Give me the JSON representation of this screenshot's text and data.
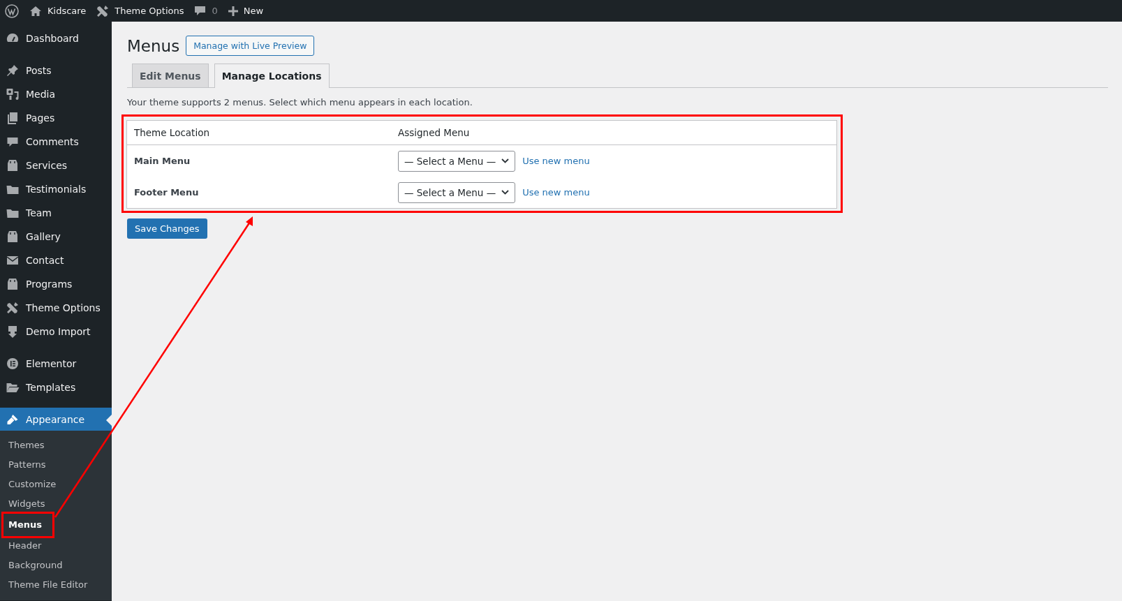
{
  "topbar": {
    "items": [
      {
        "kind": "logo"
      },
      {
        "kind": "home",
        "label": "Kidscare"
      },
      {
        "kind": "tools",
        "label": "Theme Options"
      },
      {
        "kind": "comments",
        "label": "0"
      },
      {
        "kind": "new",
        "label": "New"
      }
    ]
  },
  "sidebar": {
    "groups": [
      [
        {
          "label": "Dashboard",
          "kind": "gauge",
          "selected": false
        }
      ],
      [
        {
          "label": "Posts",
          "kind": "pin",
          "selected": false
        },
        {
          "label": "Media",
          "kind": "media",
          "selected": false
        },
        {
          "label": "Pages",
          "kind": "pages",
          "selected": false
        },
        {
          "label": "Comments",
          "kind": "comment",
          "selected": false
        },
        {
          "label": "Services",
          "kind": "bag",
          "selected": false
        },
        {
          "label": "Testimonials",
          "kind": "folder",
          "selected": false
        },
        {
          "label": "Team",
          "kind": "folder",
          "selected": false
        },
        {
          "label": "Gallery",
          "kind": "bag",
          "selected": false
        },
        {
          "label": "Contact",
          "kind": "envelope",
          "selected": false
        },
        {
          "label": "Programs",
          "kind": "bag",
          "selected": false
        },
        {
          "label": "Theme Options",
          "kind": "tools",
          "selected": false
        },
        {
          "label": "Demo Import",
          "kind": "download",
          "selected": false
        }
      ],
      [
        {
          "label": "Elementor",
          "kind": "circle",
          "selected": false
        },
        {
          "label": "Templates",
          "kind": "folder-open",
          "selected": false
        }
      ],
      [
        {
          "label": "Appearance",
          "kind": "brush",
          "selected": true,
          "children": [
            {
              "label": "Themes",
              "selected": false,
              "annotated": false
            },
            {
              "label": "Patterns",
              "selected": false,
              "annotated": false
            },
            {
              "label": "Customize",
              "selected": false,
              "annotated": false
            },
            {
              "label": "Widgets",
              "selected": false,
              "annotated": false
            },
            {
              "label": "Menus",
              "selected": true,
              "annotated": true
            },
            {
              "label": "Header",
              "selected": false,
              "annotated": false
            },
            {
              "label": "Background",
              "selected": false,
              "annotated": false
            },
            {
              "label": "Theme File Editor",
              "selected": false,
              "annotated": false
            }
          ]
        }
      ]
    ]
  },
  "page": {
    "title": "Menus",
    "action_button": "Manage with Live Preview",
    "tabs": [
      {
        "label": "Edit Menus",
        "selected": false
      },
      {
        "label": "Manage Locations",
        "selected": true
      }
    ],
    "description": "Your theme supports 2 menus. Select which menu appears in each location.",
    "locations_table": {
      "annotated": true,
      "columns": [
        "Theme Location",
        "Assigned Menu"
      ],
      "rows": [
        {
          "location": "Main Menu",
          "menu": "— Select a Menu —",
          "link": "Use new menu"
        },
        {
          "location": "Footer Menu",
          "menu": "— Select a Menu —",
          "link": "Use new menu"
        }
      ]
    },
    "save_button": "Save Changes"
  },
  "annotation_arrow": {
    "shown": true
  }
}
